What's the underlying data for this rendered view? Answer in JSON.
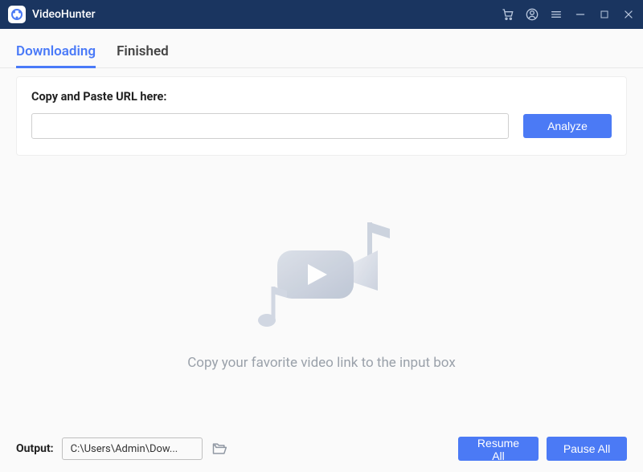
{
  "app": {
    "title": "VideoHunter"
  },
  "tabs": {
    "downloading": "Downloading",
    "finished": "Finished"
  },
  "card": {
    "label": "Copy and Paste URL here:",
    "input_value": "",
    "analyze_label": "Analyze"
  },
  "empty": {
    "text": "Copy your favorite video link to the input box"
  },
  "bottom": {
    "output_label": "Output:",
    "output_path": "C:\\Users\\Admin\\Dow...",
    "resume_label": "Resume All",
    "pause_label": "Pause All"
  },
  "colors": {
    "primary": "#4b7af5",
    "titlebar": "#1a3560"
  }
}
